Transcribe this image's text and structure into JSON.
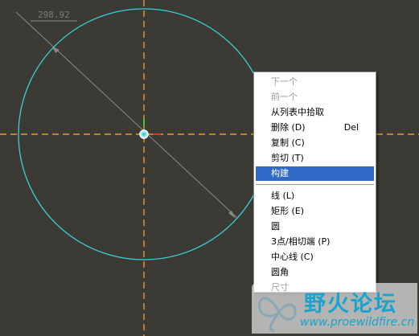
{
  "sketch": {
    "dimension_value": "298.92"
  },
  "context_menu": {
    "items": [
      {
        "label": "下一个",
        "disabled": true
      },
      {
        "label": "前一个",
        "disabled": true
      },
      {
        "label": "从列表中拾取"
      },
      {
        "label": "删除 (D)",
        "shortcut": "Del"
      },
      {
        "label": "复制 (C)"
      },
      {
        "label": "剪切 (T)"
      },
      {
        "label": "构建",
        "selected": true
      },
      {
        "label": "线 (L)"
      },
      {
        "label": "矩形 (E)"
      },
      {
        "label": "圆"
      },
      {
        "label": "3点/相切端 (P)"
      },
      {
        "label": "中心线 (C)"
      },
      {
        "label": "圆角"
      },
      {
        "label": "尺寸"
      }
    ]
  },
  "watermark": {
    "title": "野火论坛",
    "url": "www.proewildfire.cn"
  },
  "colors": {
    "background": "#3c3a35",
    "circle": "#37d2d9",
    "centerline": "#e89a2e",
    "menu_highlight": "#3169c6",
    "watermark_text": "#1aa3cf"
  }
}
